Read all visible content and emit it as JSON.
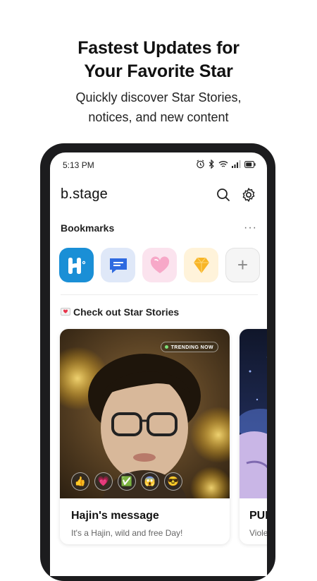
{
  "promo": {
    "title_line1": "Fastest Updates for",
    "title_line2": "Your Favorite Star",
    "subtitle_line1": "Quickly discover Star Stories,",
    "subtitle_line2": "notices, and new content"
  },
  "status": {
    "time": "5:13 PM",
    "icons": [
      "alarm-icon",
      "bluetooth-icon",
      "wifi-icon",
      "signal-icon",
      "battery-icon"
    ]
  },
  "app": {
    "logo": "b.stage",
    "search_icon": "search-icon",
    "settings_icon": "gear-icon"
  },
  "bookmarks": {
    "heading": "Bookmarks",
    "more": "···",
    "items": [
      {
        "name": "hajin-app-icon",
        "color": "#1a8fd6"
      },
      {
        "name": "chat-app-icon",
        "color": "#dfe8f8"
      },
      {
        "name": "heart-app-icon",
        "color": "#fbe3ee"
      },
      {
        "name": "gem-app-icon",
        "color": "#fff3da"
      }
    ],
    "add": "+"
  },
  "stories": {
    "heading": "Check out Star Stories",
    "cards": [
      {
        "badge": "TRENDING NOW",
        "title": "Hajin's message",
        "desc": "It's a Hajin, wild and free Day!",
        "reactions": [
          "👍",
          "💗",
          "✅",
          "😱",
          "😎"
        ]
      },
      {
        "title": "PUR",
        "desc": "Viole"
      }
    ]
  },
  "colors": {
    "phone_frame": "#1c1c1e",
    "badge_dot": "#7ee07a",
    "bookmark_blue": "#1a8fd6"
  }
}
